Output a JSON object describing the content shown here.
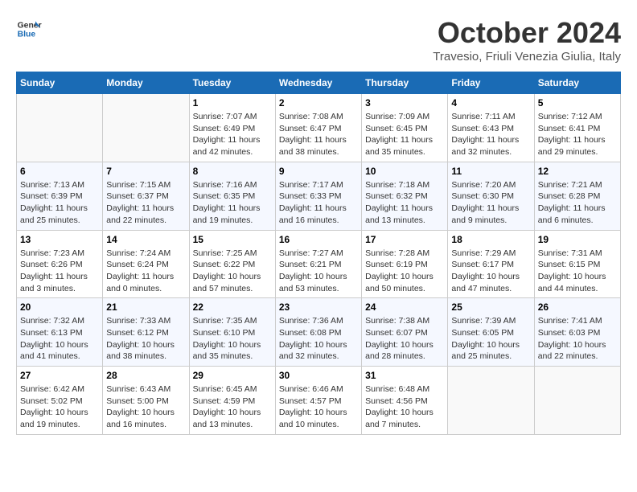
{
  "header": {
    "logo_line1": "General",
    "logo_line2": "Blue",
    "month": "October 2024",
    "location": "Travesio, Friuli Venezia Giulia, Italy"
  },
  "days_of_week": [
    "Sunday",
    "Monday",
    "Tuesday",
    "Wednesday",
    "Thursday",
    "Friday",
    "Saturday"
  ],
  "weeks": [
    [
      {
        "day": "",
        "empty": true
      },
      {
        "day": "",
        "empty": true
      },
      {
        "day": "1",
        "sunrise": "Sunrise: 7:07 AM",
        "sunset": "Sunset: 6:49 PM",
        "daylight": "Daylight: 11 hours and 42 minutes."
      },
      {
        "day": "2",
        "sunrise": "Sunrise: 7:08 AM",
        "sunset": "Sunset: 6:47 PM",
        "daylight": "Daylight: 11 hours and 38 minutes."
      },
      {
        "day": "3",
        "sunrise": "Sunrise: 7:09 AM",
        "sunset": "Sunset: 6:45 PM",
        "daylight": "Daylight: 11 hours and 35 minutes."
      },
      {
        "day": "4",
        "sunrise": "Sunrise: 7:11 AM",
        "sunset": "Sunset: 6:43 PM",
        "daylight": "Daylight: 11 hours and 32 minutes."
      },
      {
        "day": "5",
        "sunrise": "Sunrise: 7:12 AM",
        "sunset": "Sunset: 6:41 PM",
        "daylight": "Daylight: 11 hours and 29 minutes."
      }
    ],
    [
      {
        "day": "6",
        "sunrise": "Sunrise: 7:13 AM",
        "sunset": "Sunset: 6:39 PM",
        "daylight": "Daylight: 11 hours and 25 minutes."
      },
      {
        "day": "7",
        "sunrise": "Sunrise: 7:15 AM",
        "sunset": "Sunset: 6:37 PM",
        "daylight": "Daylight: 11 hours and 22 minutes."
      },
      {
        "day": "8",
        "sunrise": "Sunrise: 7:16 AM",
        "sunset": "Sunset: 6:35 PM",
        "daylight": "Daylight: 11 hours and 19 minutes."
      },
      {
        "day": "9",
        "sunrise": "Sunrise: 7:17 AM",
        "sunset": "Sunset: 6:33 PM",
        "daylight": "Daylight: 11 hours and 16 minutes."
      },
      {
        "day": "10",
        "sunrise": "Sunrise: 7:18 AM",
        "sunset": "Sunset: 6:32 PM",
        "daylight": "Daylight: 11 hours and 13 minutes."
      },
      {
        "day": "11",
        "sunrise": "Sunrise: 7:20 AM",
        "sunset": "Sunset: 6:30 PM",
        "daylight": "Daylight: 11 hours and 9 minutes."
      },
      {
        "day": "12",
        "sunrise": "Sunrise: 7:21 AM",
        "sunset": "Sunset: 6:28 PM",
        "daylight": "Daylight: 11 hours and 6 minutes."
      }
    ],
    [
      {
        "day": "13",
        "sunrise": "Sunrise: 7:23 AM",
        "sunset": "Sunset: 6:26 PM",
        "daylight": "Daylight: 11 hours and 3 minutes."
      },
      {
        "day": "14",
        "sunrise": "Sunrise: 7:24 AM",
        "sunset": "Sunset: 6:24 PM",
        "daylight": "Daylight: 11 hours and 0 minutes."
      },
      {
        "day": "15",
        "sunrise": "Sunrise: 7:25 AM",
        "sunset": "Sunset: 6:22 PM",
        "daylight": "Daylight: 10 hours and 57 minutes."
      },
      {
        "day": "16",
        "sunrise": "Sunrise: 7:27 AM",
        "sunset": "Sunset: 6:21 PM",
        "daylight": "Daylight: 10 hours and 53 minutes."
      },
      {
        "day": "17",
        "sunrise": "Sunrise: 7:28 AM",
        "sunset": "Sunset: 6:19 PM",
        "daylight": "Daylight: 10 hours and 50 minutes."
      },
      {
        "day": "18",
        "sunrise": "Sunrise: 7:29 AM",
        "sunset": "Sunset: 6:17 PM",
        "daylight": "Daylight: 10 hours and 47 minutes."
      },
      {
        "day": "19",
        "sunrise": "Sunrise: 7:31 AM",
        "sunset": "Sunset: 6:15 PM",
        "daylight": "Daylight: 10 hours and 44 minutes."
      }
    ],
    [
      {
        "day": "20",
        "sunrise": "Sunrise: 7:32 AM",
        "sunset": "Sunset: 6:13 PM",
        "daylight": "Daylight: 10 hours and 41 minutes."
      },
      {
        "day": "21",
        "sunrise": "Sunrise: 7:33 AM",
        "sunset": "Sunset: 6:12 PM",
        "daylight": "Daylight: 10 hours and 38 minutes."
      },
      {
        "day": "22",
        "sunrise": "Sunrise: 7:35 AM",
        "sunset": "Sunset: 6:10 PM",
        "daylight": "Daylight: 10 hours and 35 minutes."
      },
      {
        "day": "23",
        "sunrise": "Sunrise: 7:36 AM",
        "sunset": "Sunset: 6:08 PM",
        "daylight": "Daylight: 10 hours and 32 minutes."
      },
      {
        "day": "24",
        "sunrise": "Sunrise: 7:38 AM",
        "sunset": "Sunset: 6:07 PM",
        "daylight": "Daylight: 10 hours and 28 minutes."
      },
      {
        "day": "25",
        "sunrise": "Sunrise: 7:39 AM",
        "sunset": "Sunset: 6:05 PM",
        "daylight": "Daylight: 10 hours and 25 minutes."
      },
      {
        "day": "26",
        "sunrise": "Sunrise: 7:41 AM",
        "sunset": "Sunset: 6:03 PM",
        "daylight": "Daylight: 10 hours and 22 minutes."
      }
    ],
    [
      {
        "day": "27",
        "sunrise": "Sunrise: 6:42 AM",
        "sunset": "Sunset: 5:02 PM",
        "daylight": "Daylight: 10 hours and 19 minutes."
      },
      {
        "day": "28",
        "sunrise": "Sunrise: 6:43 AM",
        "sunset": "Sunset: 5:00 PM",
        "daylight": "Daylight: 10 hours and 16 minutes."
      },
      {
        "day": "29",
        "sunrise": "Sunrise: 6:45 AM",
        "sunset": "Sunset: 4:59 PM",
        "daylight": "Daylight: 10 hours and 13 minutes."
      },
      {
        "day": "30",
        "sunrise": "Sunrise: 6:46 AM",
        "sunset": "Sunset: 4:57 PM",
        "daylight": "Daylight: 10 hours and 10 minutes."
      },
      {
        "day": "31",
        "sunrise": "Sunrise: 6:48 AM",
        "sunset": "Sunset: 4:56 PM",
        "daylight": "Daylight: 10 hours and 7 minutes."
      },
      {
        "day": "",
        "empty": true
      },
      {
        "day": "",
        "empty": true
      }
    ]
  ]
}
